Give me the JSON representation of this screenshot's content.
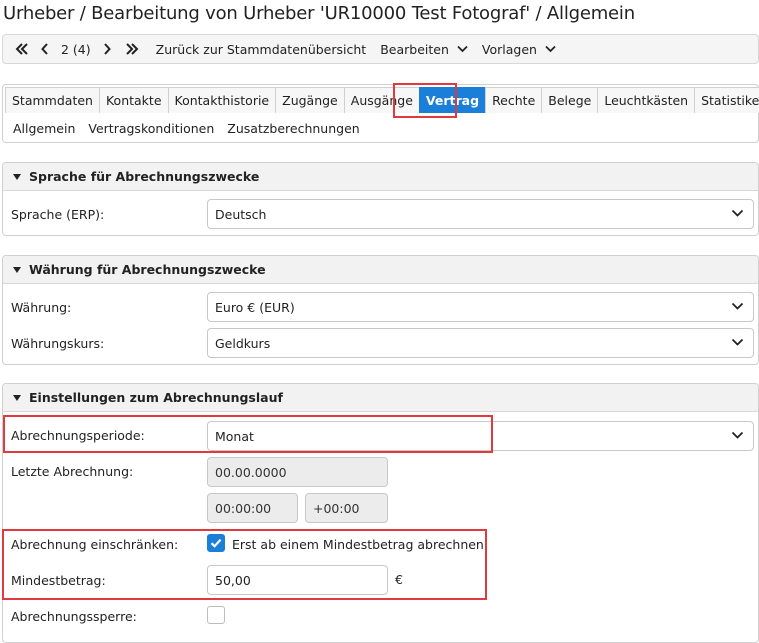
{
  "page": {
    "title": "Urheber / Bearbeitung von Urheber 'UR10000 Test Fotograf' / Allgemein"
  },
  "toolbar": {
    "pager": "2 (4)",
    "back_label": "Zurück zur Stammdatenübersicht",
    "edit_label": "Bearbeiten",
    "templates_label": "Vorlagen"
  },
  "tabs": [
    {
      "label": "Stammdaten"
    },
    {
      "label": "Kontakte"
    },
    {
      "label": "Kontakthistorie"
    },
    {
      "label": "Zugänge"
    },
    {
      "label": "Ausgänge"
    },
    {
      "label": "Vertrag",
      "active": true
    },
    {
      "label": "Rechte"
    },
    {
      "label": "Belege"
    },
    {
      "label": "Leuchtkästen"
    },
    {
      "label": "Statistiken"
    }
  ],
  "subtabs": [
    "Allgemein",
    "Vertragskonditionen",
    "Zusatzberechnungen"
  ],
  "sections": {
    "language": {
      "title": "Sprache für Abrechnungszwecke",
      "label": "Sprache (ERP):",
      "value": "Deutsch"
    },
    "currency": {
      "title": "Währung für Abrechnungszwecke",
      "currency_label": "Währung:",
      "currency_value": "Euro € (EUR)",
      "rate_label": "Währungskurs:",
      "rate_value": "Geldkurs"
    },
    "run": {
      "title": "Einstellungen zum Abrechnungslauf",
      "period_label": "Abrechnungsperiode:",
      "period_value": "Monat",
      "last_label": "Letzte Abrechnung:",
      "last_date": "00.00.0000",
      "last_time": "00:00:00",
      "last_tz": "+00:00",
      "limit_label": "Abrechnung einschränken:",
      "limit_checkbox_label": "Erst ab einem Mindestbetrag abrechnen",
      "limit_checked": true,
      "min_label": "Mindestbetrag:",
      "min_value": "50,00",
      "min_unit": "€",
      "lock_label": "Abrechnungssperre:",
      "lock_checked": false
    }
  },
  "colors": {
    "accent": "#1a7fd8",
    "highlight": "#e0393e"
  }
}
